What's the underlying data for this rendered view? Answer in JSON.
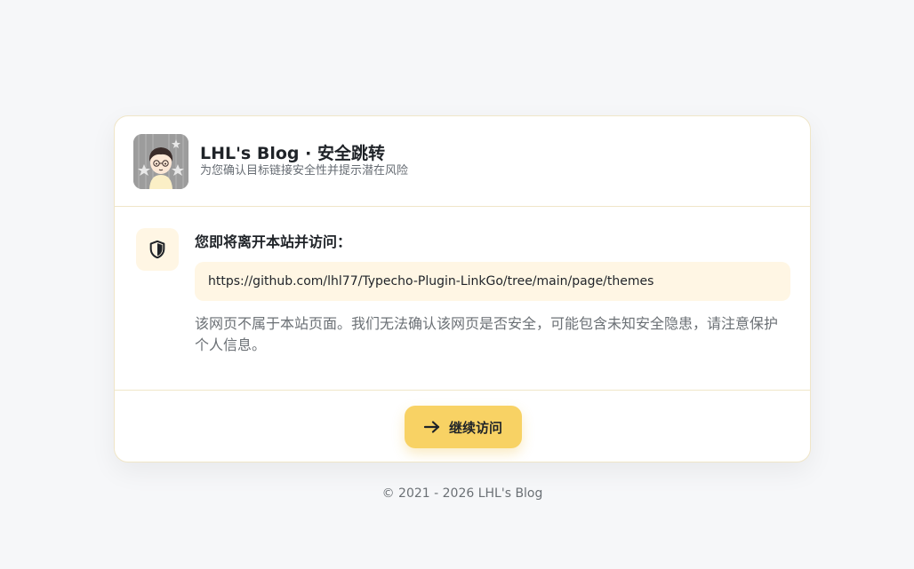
{
  "header": {
    "site_title": "LHL's Blog · 安全跳转",
    "subtitle": "为您确认目标链接安全性并提示潜在风险",
    "avatar_icon": "avatar-cartoon-boy-icon"
  },
  "content": {
    "shield_icon": "shield-icon",
    "leave_title": "您即将离开本站并访问：",
    "url": "https://github.com/lhl77/Typecho-Plugin-LinkGo/tree/main/page/themes",
    "warning": "该网页不属于本站页面。我们无法确认该网页是否安全，可能包含未知安全隐患，请注意保护个人信息。"
  },
  "actions": {
    "continue_label": "继续访问",
    "continue_icon": "arrow-right-icon"
  },
  "footer": {
    "copyright": "© 2021 - 2026 LHL's Blog"
  },
  "colors": {
    "accent": "#f8d264",
    "url_bg": "#fff6e4",
    "border": "#f0e6c8",
    "page_bg": "#f6f7f9"
  }
}
